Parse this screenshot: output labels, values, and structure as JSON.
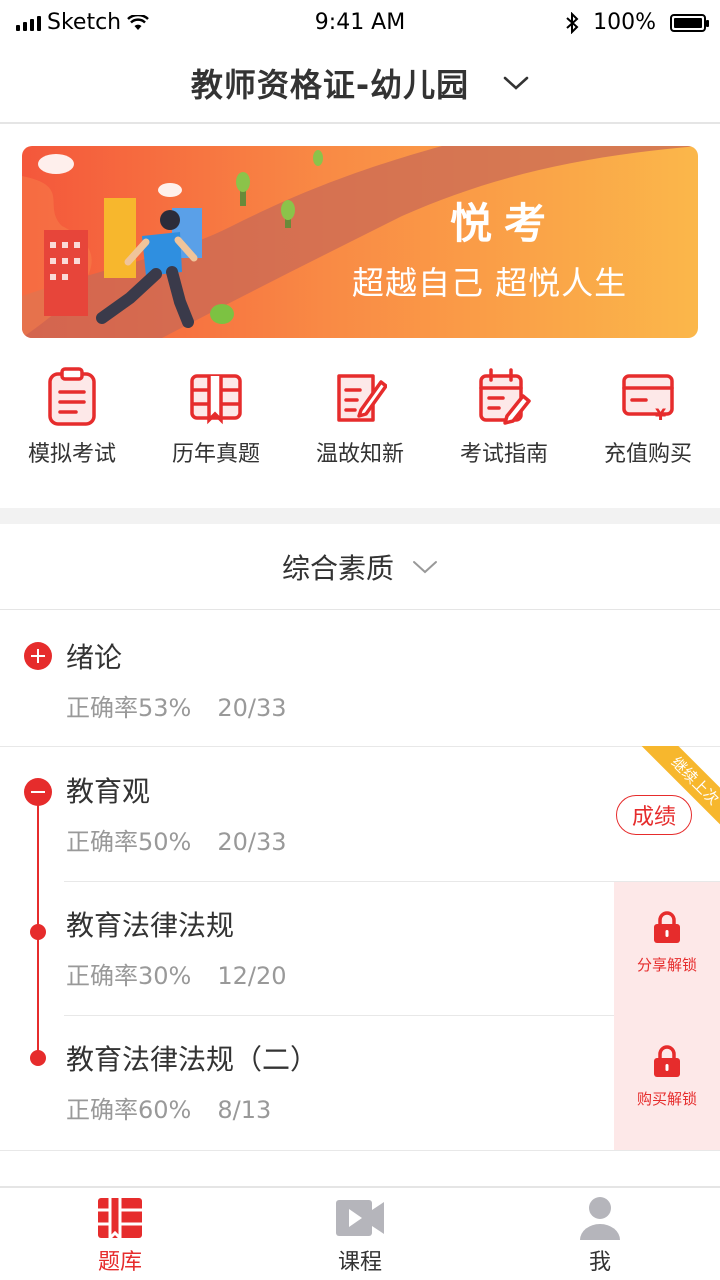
{
  "status_bar": {
    "carrier": "Sketch",
    "time": "9:41 AM",
    "battery": "100%"
  },
  "header": {
    "title": "教师资格证-幼儿园"
  },
  "banner": {
    "title": "悦考",
    "subtitle": "超越自己  超悦人生"
  },
  "shortcuts": [
    {
      "label": "模拟考试",
      "icon": "clipboard-icon"
    },
    {
      "label": "历年真题",
      "icon": "book-icon"
    },
    {
      "label": "温故知新",
      "icon": "note-pen-icon"
    },
    {
      "label": "考试指南",
      "icon": "calendar-pen-icon"
    },
    {
      "label": "充值购买",
      "icon": "card-yen-icon"
    }
  ],
  "subject": {
    "label": "综合素质"
  },
  "chapters": [
    {
      "title": "绪论",
      "accuracy": "正确率53%",
      "progress": "20/33"
    },
    {
      "title": "教育观",
      "accuracy": "正确率50%",
      "progress": "20/33",
      "score_label": "成绩",
      "ribbon": "继续上次"
    },
    {
      "title": "教育法律法规",
      "accuracy": "正确率30%",
      "progress": "12/20",
      "unlock_label": "分享解锁"
    },
    {
      "title": "教育法律法规（二）",
      "accuracy": "正确率60%",
      "progress": "8/13",
      "unlock_label": "购买解锁"
    }
  ],
  "tabs": [
    {
      "label": "题库",
      "icon": "question-bank-icon"
    },
    {
      "label": "课程",
      "icon": "video-icon"
    },
    {
      "label": "我",
      "icon": "user-icon"
    }
  ],
  "colors": {
    "accent": "#e62c2c",
    "ribbon": "#f7b72d",
    "unlock_bg": "#fde8e8"
  }
}
